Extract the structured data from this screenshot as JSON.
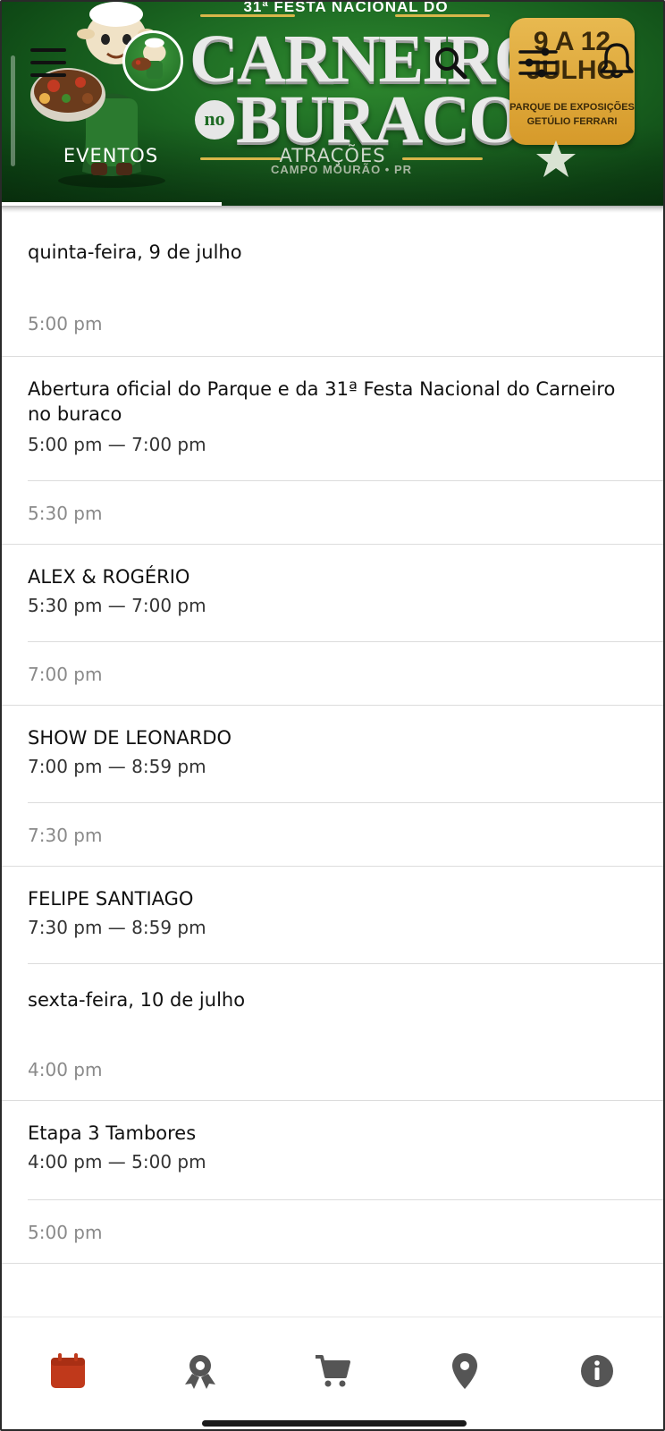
{
  "header": {
    "banner_top": "31ª FESTA NACIONAL DO",
    "title_line1": "CARNEIRO",
    "title_no": "no",
    "title_line2": "BURACO",
    "city": "CAMPO MOURÃO • PR",
    "date_line1": "9 A 12",
    "date_line2": "JULHO",
    "venue": "PARQUE DE EXPOSIÇÕES GETÚLIO FERRARI",
    "icons": [
      "menu-icon",
      "search-icon",
      "filter-icon",
      "bell-icon"
    ],
    "colors": {
      "banner_green": "#1d6a23",
      "badge_gold": "#e0aa3c"
    }
  },
  "tabs": [
    {
      "label": "EVENTOS",
      "active": true
    },
    {
      "label": "ATRAÇÕES",
      "active": false
    }
  ],
  "schedule": {
    "days": [
      {
        "date": "quinta-feira, 9 de julho",
        "slots": [
          {
            "time": "5:00 pm",
            "events": [
              {
                "title": "Abertura oficial do Parque e da 31ª Festa Nacional do Carneiro no buraco",
                "range": "5:00 pm — 7:00 pm"
              }
            ]
          },
          {
            "time": "5:30 pm",
            "events": [
              {
                "title": "ALEX & ROGÉRIO",
                "range": "5:30 pm — 7:00 pm"
              }
            ]
          },
          {
            "time": "7:00 pm",
            "events": [
              {
                "title": "SHOW DE LEONARDO",
                "range": "7:00 pm — 8:59 pm"
              }
            ]
          },
          {
            "time": "7:30 pm",
            "events": [
              {
                "title": "FELIPE SANTIAGO",
                "range": "7:30 pm — 8:59 pm"
              }
            ]
          }
        ]
      },
      {
        "date": "sexta-feira, 10 de julho",
        "slots": [
          {
            "time": "4:00 pm",
            "events": [
              {
                "title": "Etapa 3 Tambores",
                "range": "4:00 pm — 5:00 pm"
              }
            ]
          },
          {
            "time": "5:00 pm",
            "events": []
          }
        ]
      }
    ]
  },
  "bottom_nav": {
    "items": [
      {
        "icon": "calendar-icon",
        "active": true,
        "color": "#c0391b"
      },
      {
        "icon": "award-icon",
        "active": false,
        "color": "#555555"
      },
      {
        "icon": "cart-icon",
        "active": false,
        "color": "#555555"
      },
      {
        "icon": "map-pin-icon",
        "active": false,
        "color": "#555555"
      },
      {
        "icon": "info-icon",
        "active": false,
        "color": "#555555"
      }
    ]
  }
}
